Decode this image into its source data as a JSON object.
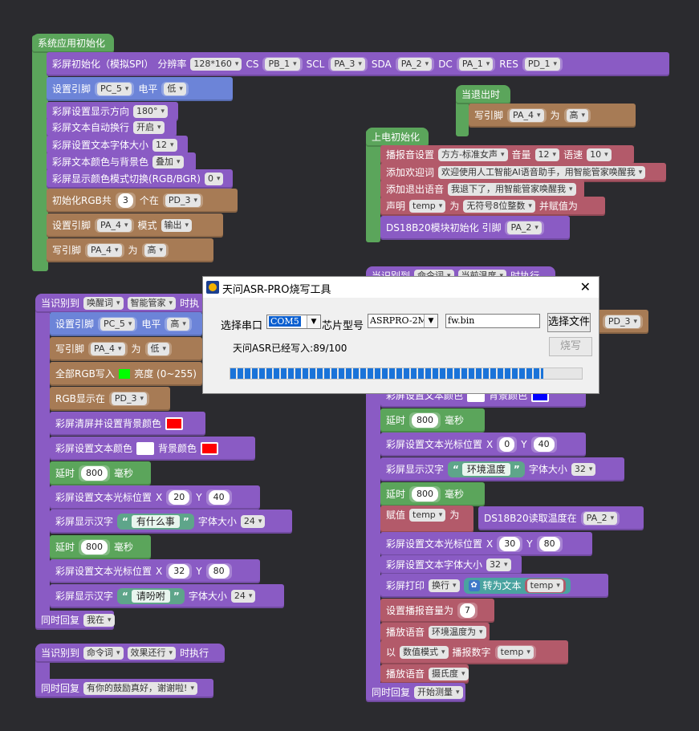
{
  "colors": {
    "background": "#2b2b2f",
    "green": "#5ba55b",
    "purple": "#8a5bc4",
    "brown": "#a77b55",
    "red_block": "#b35a6a",
    "progress": "#1a73d9"
  },
  "group_init": {
    "hat": "系统应用初始化",
    "screen_init": {
      "label": "彩屏初始化（模拟SPI）",
      "res_label": "分辨率",
      "res": "128*160",
      "cs_label": "CS",
      "cs": "PB_1",
      "scl_label": "SCL",
      "scl": "PA_3",
      "sda_label": "SDA",
      "sda": "PA_2",
      "dc_label": "DC",
      "dc": "PA_1",
      "res_pin_label": "RES",
      "res_pin": "PD_1"
    },
    "set_pin": {
      "label": "设置引脚",
      "pin": "PC_5",
      "level_label": "电平",
      "level": "低"
    },
    "direction": {
      "label": "彩屏设置显示方向",
      "value": "180°"
    },
    "wrap": {
      "label": "彩屏文本自动换行",
      "value": "开启"
    },
    "font_size": {
      "label": "彩屏设置文本字体大小",
      "value": "12"
    },
    "text_color": {
      "label": "彩屏文本颜色与背景色",
      "value": "叠加"
    },
    "color_mode": {
      "label": "彩屏显示颜色模式切换(RGB/BGR)",
      "value": "0"
    },
    "rgb_init": {
      "label": "初始化RGB共",
      "count": "3",
      "at_label": "个在",
      "pin": "PD_3"
    },
    "pin_mode": {
      "label": "设置引脚",
      "pin": "PA_4",
      "mode_label": "模式",
      "mode": "输出"
    },
    "write_pin": {
      "label": "写引脚",
      "pin": "PA_4",
      "as_label": "为",
      "value": "高"
    }
  },
  "group_exit": {
    "hat": "当退出时",
    "write_label": "写引脚",
    "pin": "PA_4",
    "as_label": "为",
    "value": "高"
  },
  "group_power": {
    "hat": "上电初始化",
    "voice": {
      "label": "播报音设置",
      "voice": "方方-标准女声",
      "vol_label": "音量",
      "vol": "12",
      "speed_label": "语速",
      "speed": "10"
    },
    "welcome": {
      "label": "添加欢迎词",
      "text": "欢迎使用人工智能AI语音助手，用智能管家唤醒我"
    },
    "exit_voice": {
      "label": "添加退出语音",
      "text": "我退下了，用智能管家唤醒我"
    },
    "declare": {
      "label": "声明",
      "var": "temp",
      "as_label": "为",
      "type": "无符号8位整数",
      "assign_label": "并赋值为"
    },
    "ds18b20": {
      "label": "DS18B20模块初始化 引脚",
      "pin": "PA_2"
    }
  },
  "group_wake": {
    "hat_label": "当识别到",
    "hat_type": "唤醒词",
    "hat_word": "智能管家",
    "hat_suffix": "时执",
    "set_pin": {
      "label": "设置引脚",
      "pin": "PC_5",
      "level_label": "电平",
      "level": "高"
    },
    "write_pin": {
      "label": "写引脚",
      "pin": "PA_4",
      "as_label": "为",
      "value": "低"
    },
    "rgb_all": {
      "label": "全部RGB写入",
      "bright_label": "亮度 (0~255)"
    },
    "rgb_show": {
      "label": "RGB显示在",
      "pin": "PD_3"
    },
    "clear": {
      "label": "彩屏清屏并设置背景颜色"
    },
    "color": {
      "label": "彩屏设置文本颜色",
      "bg_label": "背景颜色"
    },
    "delay1": {
      "label": "延时",
      "value": "800",
      "unit": "毫秒"
    },
    "cursor1": {
      "label": "彩屏设置文本光标位置",
      "x_label": "X",
      "x": "20",
      "y_label": "Y",
      "y": "40"
    },
    "text1": {
      "label": "彩屏显示汉字",
      "text": "有什么事",
      "size_label": "字体大小",
      "size": "24"
    },
    "delay2": {
      "label": "延时",
      "value": "800",
      "unit": "毫秒"
    },
    "cursor2": {
      "label": "彩屏设置文本光标位置",
      "x_label": "X",
      "x": "32",
      "y_label": "Y",
      "y": "80"
    },
    "text2": {
      "label": "彩屏显示汉字",
      "text": "请吩咐",
      "size_label": "字体大小",
      "size": "24"
    },
    "reply_label": "同时回复",
    "reply": "我在"
  },
  "group_cmd1": {
    "hat_label": "当识别到",
    "hat_type": "命令词",
    "hat_word": "效果还行",
    "hat_suffix": "时执行",
    "reply_label": "同时回复",
    "reply": "有你的鼓励真好，谢谢啦!"
  },
  "group_cmd2": {
    "hat_label": "当识别到",
    "hat_type": "命令词",
    "hat_word": "当前温度",
    "hat_suffix": "时执行",
    "pd3": "PD_3",
    "color": {
      "label": "彩屏设置文本颜色",
      "bg_label": "背景颜色"
    },
    "delay1": {
      "label": "延时",
      "value": "800",
      "unit": "毫秒"
    },
    "cursor1": {
      "label": "彩屏设置文本光标位置",
      "x_label": "X",
      "x": "0",
      "y_label": "Y",
      "y": "40"
    },
    "text1": {
      "label": "彩屏显示汉字",
      "text": "环境温度",
      "size_label": "字体大小",
      "size": "32"
    },
    "delay2": {
      "label": "延时",
      "value": "800",
      "unit": "毫秒"
    },
    "assign": {
      "label": "赋值",
      "var": "temp",
      "as_label": "为",
      "read_label": "DS18B20读取温度在",
      "pin": "PA_2"
    },
    "cursor2": {
      "label": "彩屏设置文本光标位置",
      "x_label": "X",
      "x": "30",
      "y_label": "Y",
      "y": "80"
    },
    "font_size": {
      "label": "彩屏设置文本字体大小",
      "value": "32"
    },
    "print": {
      "label": "彩屏打印",
      "mode": "换行",
      "conv_label": "转为文本",
      "var": "temp"
    },
    "volume": {
      "label": "设置播报音量为",
      "value": "7"
    },
    "play1": {
      "label": "播放语音",
      "text": "环境温度为"
    },
    "play_num": {
      "prefix": "以",
      "mode": "数值模式",
      "label": "播报数字",
      "var": "temp"
    },
    "play2": {
      "label": "播放语音",
      "text": "摄氏度"
    },
    "reply_label": "同时回复",
    "reply": "开始测量"
  },
  "dialog": {
    "title": "天问ASR-PRO烧写工具",
    "close": "✕",
    "port_label": "选择串口",
    "port": "COM5",
    "chip_label": "芯片型号",
    "chip": "ASRPRO-2M",
    "file": "fw.bin",
    "choose_file": "选择文件",
    "status": "天问ASR已经写入:89/100",
    "burn": "烧写",
    "progress": 0.89
  }
}
